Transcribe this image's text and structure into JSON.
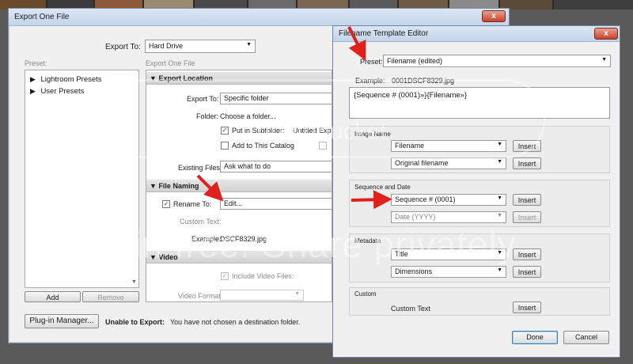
{
  "export_dialog": {
    "title": "Export One File",
    "export_to_label": "Export To:",
    "export_to_value": "Hard Drive",
    "preset_label": "Preset:",
    "panel_caption": "Export One File",
    "presets": [
      "Lightroom Presets",
      "User Presets"
    ],
    "add_label": "Add",
    "remove_label": "Remove",
    "export_location": {
      "header": "Export Location",
      "export_to_label": "Export To:",
      "export_to_value": "Specific folder",
      "folder_label": "Folder:",
      "folder_value": "Choose a folder...",
      "subfolder_label": "Put in Subfolder:",
      "subfolder_value": "Untitled Export",
      "add_catalog_label": "Add to This Catalog",
      "existing_files_label": "Existing Files:",
      "existing_files_value": "Ask what to do"
    },
    "file_naming": {
      "header": "File Naming",
      "rename_label": "Rename To:",
      "rename_value": "Edit...",
      "custom_text_label": "Custom Text:",
      "example_label": "Example:",
      "example_value": "DSCF8329.jpg"
    },
    "video": {
      "header": "Video",
      "include_label": "Include Video Files:",
      "format_label": "Video Format:"
    },
    "plugin_manager_label": "Plug-in Manager...",
    "unable_label": "Unable to Export:",
    "unable_message": "You have not chosen a destination folder.",
    "close_glyph": "x"
  },
  "template_editor": {
    "title": "Filename Template Editor",
    "preset_label": "Preset:",
    "preset_value": "Filename (edited)",
    "example_label": "Example:",
    "example_value": "0001DSCF8329.jpg",
    "template_text": "{Sequence # (0001)»}{Filename»}",
    "image_name": {
      "header": "Image Name",
      "row1_value": "Filename",
      "row2_value": "Original filename"
    },
    "sequence_date": {
      "header": "Sequence and Date",
      "row1_value": "Sequence # (0001)",
      "row2_value": "Date (YYYY)"
    },
    "metadata": {
      "header": "Metadata",
      "row1_value": "Title",
      "row2_value": "Dimensions"
    },
    "custom": {
      "header": "Custom",
      "row1_value": "Custom Text"
    },
    "insert_label": "Insert",
    "done_label": "Done",
    "cancel_label": "Cancel",
    "close_glyph": "x"
  },
  "watermark": {
    "top": "photobucket",
    "main": "Join free. Share privately"
  },
  "colors": {
    "accent_red": "#e0201a",
    "title_blue": "#c3d4ea",
    "close_red": "#c7432c"
  }
}
